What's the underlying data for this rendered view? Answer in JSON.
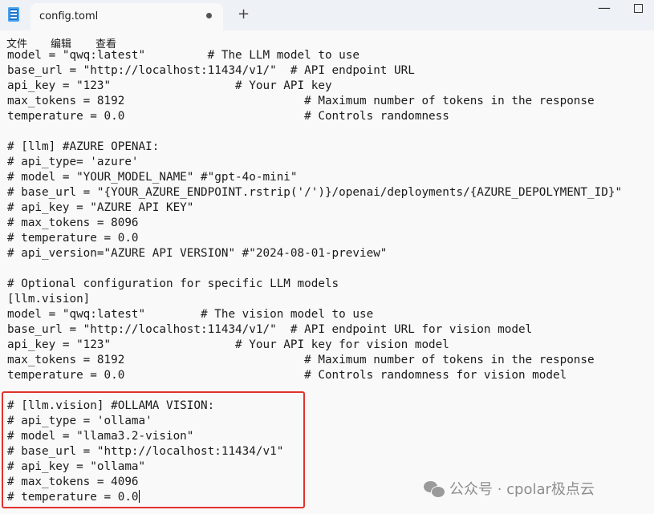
{
  "window": {
    "tab_title": "config.toml",
    "new_tab_label": "+",
    "minimize_label": "—"
  },
  "menu": {
    "file": "文件",
    "edit": "编辑",
    "view": "查看"
  },
  "editor": {
    "lines": [
      "model = \"qwq:latest\"         # The LLM model to use",
      "base_url = \"http://localhost:11434/v1/\"  # API endpoint URL",
      "api_key = \"123\"                  # Your API key",
      "max_tokens = 8192                          # Maximum number of tokens in the response",
      "temperature = 0.0                          # Controls randomness",
      "",
      "# [llm] #AZURE OPENAI:",
      "# api_type= 'azure'",
      "# model = \"YOUR_MODEL_NAME\" #\"gpt-4o-mini\"",
      "# base_url = \"{YOUR_AZURE_ENDPOINT.rstrip('/')}/openai/deployments/{AZURE_DEPOLYMENT_ID}\"",
      "# api_key = \"AZURE API KEY\"",
      "# max_tokens = 8096",
      "# temperature = 0.0",
      "# api_version=\"AZURE API VERSION\" #\"2024-08-01-preview\"",
      "",
      "# Optional configuration for specific LLM models",
      "[llm.vision]",
      "model = \"qwq:latest\"        # The vision model to use",
      "base_url = \"http://localhost:11434/v1/\"  # API endpoint URL for vision model",
      "api_key = \"123\"                  # Your API key for vision model",
      "max_tokens = 8192                          # Maximum number of tokens in the response",
      "temperature = 0.0                          # Controls randomness for vision model",
      "",
      "# [llm.vision] #OLLAMA VISION:",
      "# api_type = 'ollama'",
      "# model = \"llama3.2-vision\"",
      "# base_url = \"http://localhost:11434/v1\"",
      "# api_key = \"ollama\"",
      "# max_tokens = 4096",
      "# temperature = 0.0"
    ]
  },
  "watermark": {
    "text": "公众号 · cpolar极点云"
  },
  "colors": {
    "highlight_border": "#e0322d",
    "titlebar_bg": "#eef1f6",
    "editor_bg": "#f9f9f9"
  }
}
